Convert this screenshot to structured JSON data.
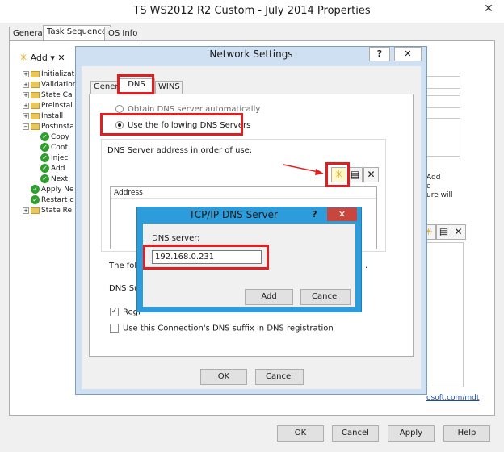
{
  "outer_window": {
    "title": "TS WS2012 R2 Custom - July 2014 Properties",
    "close_glyph": "✕",
    "tabs": [
      "General",
      "Task Sequence",
      "OS Info"
    ],
    "toolbar": {
      "add_label": "Add",
      "add_dropdown_glyph": "▾",
      "remove_glyph": "✕"
    },
    "tree": [
      {
        "label": "Initializat",
        "kind": "folder",
        "expander": "+"
      },
      {
        "label": "Validation",
        "kind": "folder",
        "expander": "+"
      },
      {
        "label": "State Ca",
        "kind": "folder",
        "expander": "+"
      },
      {
        "label": "Preinstal",
        "kind": "folder",
        "expander": "+"
      },
      {
        "label": "Install",
        "kind": "folder",
        "expander": "+"
      },
      {
        "label": "Postinsta",
        "kind": "folder",
        "expander": "−"
      },
      {
        "label": "Copy",
        "kind": "step"
      },
      {
        "label": "Conf",
        "kind": "step"
      },
      {
        "label": "Injec",
        "kind": "step"
      },
      {
        "label": "Add",
        "kind": "step"
      },
      {
        "label": "Next",
        "kind": "step"
      },
      {
        "label": "Apply Ne",
        "kind": "step"
      },
      {
        "label": "Restart c",
        "kind": "step"
      },
      {
        "label": "State Re",
        "kind": "folder",
        "expander": "+"
      }
    ],
    "right_panel_text": [
      "Add",
      "e",
      "ure will"
    ],
    "mdt_link": "osoft.com/mdt",
    "buttons": {
      "ok": "OK",
      "cancel": "Cancel",
      "apply": "Apply",
      "help": "Help"
    }
  },
  "network_settings": {
    "title": "Network Settings",
    "help_glyph": "?",
    "close_glyph": "✕",
    "tabs": [
      "General",
      "DNS",
      "WINS"
    ],
    "active_tab": "DNS",
    "radio_auto": "Obtain DNS server automatically",
    "radio_manual": "Use the following DNS Servers",
    "dns_order_label": "DNS Server address in order of use:",
    "list_column": "Address",
    "toolbar_icons": {
      "add": "✳",
      "edit": "▤",
      "delete": "✕"
    },
    "partial_label_1": "The follo",
    "partial_label_2": "DNS Suffi",
    "partial_dot": ".",
    "register_checkbox": {
      "label": "Regi",
      "checked_glyph": "✓"
    },
    "suffix_checkbox": {
      "label": "Use this Connection's DNS suffix in DNS registration",
      "checked": false
    },
    "buttons": {
      "ok": "OK",
      "cancel": "Cancel"
    }
  },
  "tcp_dialog": {
    "title": "TCP/IP DNS Server",
    "help_glyph": "?",
    "close_glyph": "✕",
    "field_label": "DNS server:",
    "field_value": "192.168.0.231",
    "buttons": {
      "add": "Add",
      "cancel": "Cancel"
    }
  },
  "annotation_colors": {
    "highlight": "#e02020",
    "dialog_accent": "#2d9cdb"
  }
}
